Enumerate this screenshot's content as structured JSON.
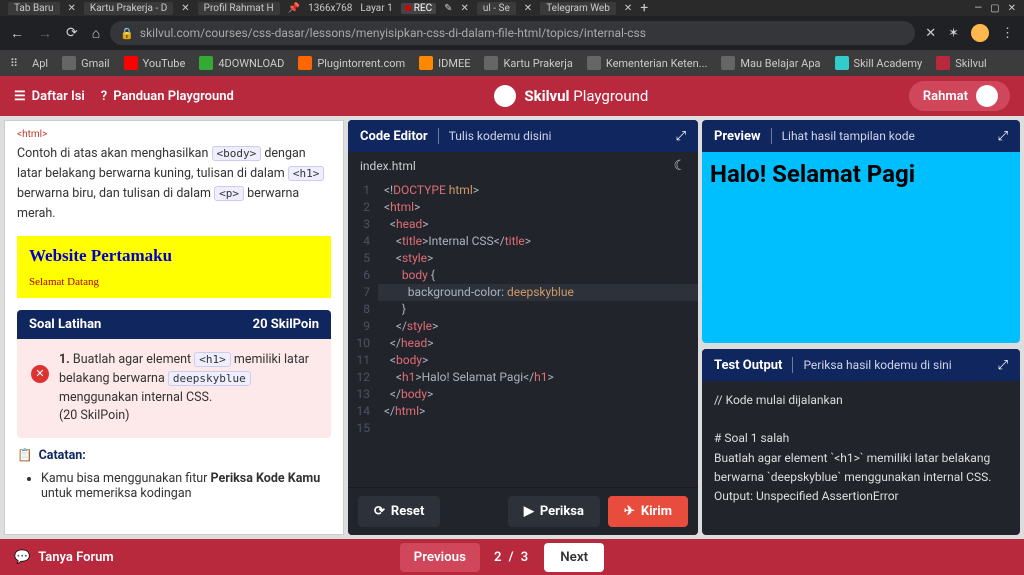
{
  "titlebar": {
    "tabs": [
      "Tab Baru",
      "Kartu Prakerja - D",
      "Profil Rahmat H",
      "ul - Se",
      "Telegram Web"
    ],
    "resolution": "1366x768",
    "layer": "Layar 1",
    "rec": "REC"
  },
  "browser": {
    "url": "skilvul.com/courses/css-dasar/lessons/menyisipkan-css-di-dalam-file-html/topics/internal-css"
  },
  "bookmarks": [
    "Apl",
    "Gmail",
    "YouTube",
    "4DOWNLOAD",
    "Plugintorrent.com",
    "IDMEE",
    "Kartu Prakerja",
    "Kementerian Keten...",
    "Mau Belajar Apa",
    "Skill Academy",
    "Skilvul"
  ],
  "header": {
    "daftar_isi": "Daftar Isi",
    "panduan": "Panduan Playground",
    "brand_strong": "Skilvul",
    "brand_light": "Playground",
    "user": "Rahmat"
  },
  "left": {
    "breadcrumb": "<html>",
    "desc_p1": "Contoh di atas akan menghasilkan",
    "tag_body": "<body>",
    "desc_p2": "dengan latar belakang berwarna kuning, tulisan di dalam",
    "tag_h1": "<h1>",
    "desc_p3": "berwarna biru, dan tulisan di dalam",
    "tag_p": "<p>",
    "desc_p4": "berwarna merah.",
    "yb_title": "Website Pertamaku",
    "yb_text": "Selamat Datang",
    "soal_title": "Soal Latihan",
    "soal_points": "20 SkilPoin",
    "soal_num": "1.",
    "soal_q1": "Buatlah agar element",
    "soal_tag": "<h1>",
    "soal_q2": "memiliki latar belakang berwarna",
    "soal_code": "deepskyblue",
    "soal_q3": "menggunakan internal CSS.",
    "soal_pts": "(20 SkilPoin)",
    "catatan_title": "Catatan:",
    "catatan_li1a": "Kamu bisa menggunakan fitur ",
    "catatan_li1b": "Periksa Kode Kamu",
    "catatan_li1c": " untuk memeriksa kodingan"
  },
  "editor": {
    "title": "Code Editor",
    "subtitle": "Tulis kodemu disini",
    "file": "index.html",
    "reset": "Reset",
    "periksa": "Periksa",
    "kirim": "Kirim"
  },
  "preview": {
    "title": "Preview",
    "subtitle": "Lihat hasil tampilan kode",
    "h1": "Halo! Selamat Pagi"
  },
  "output": {
    "title": "Test Output",
    "subtitle": "Periksa hasil kodemu di sini",
    "l1": "// Kode mulai dijalankan",
    "l2": "# Soal 1 salah",
    "l3": "Buatlah agar element `<h1>` memiliki latar belakang berwarna `deepskyblue` menggunakan internal CSS.",
    "l4": "Output: Unspecified AssertionError"
  },
  "bottom": {
    "forum": "Tanya Forum",
    "prev": "Previous",
    "pager": "2 / 3",
    "next": "Next"
  }
}
